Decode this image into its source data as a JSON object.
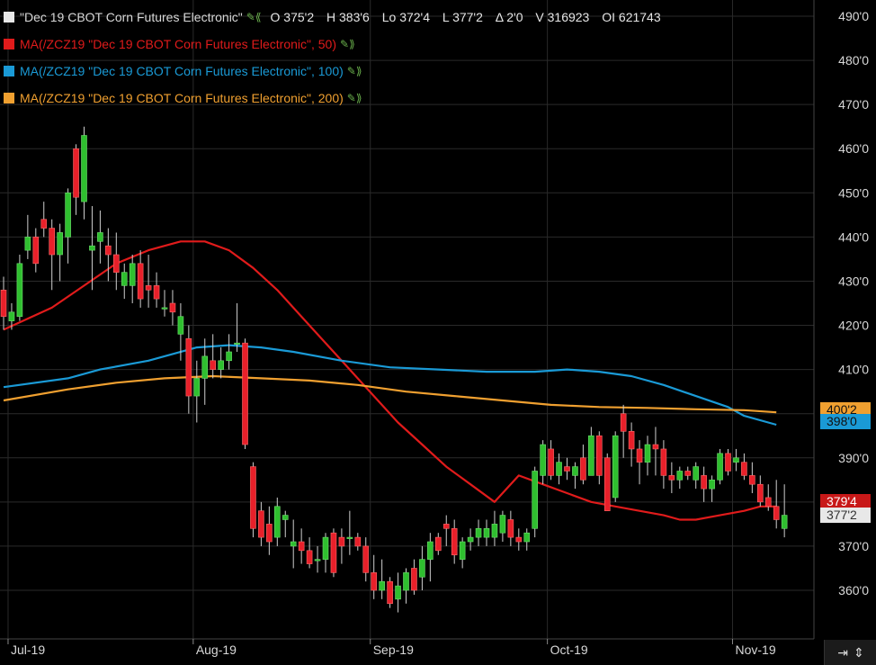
{
  "legend": {
    "main": {
      "label": "\"Dec 19 CBOT Corn Futures Electronic\"",
      "color": "#e8e8e8",
      "stats": {
        "open": "O 375'2",
        "high": "H 383'6",
        "low": "Lo 372'4",
        "last": "L 377'2",
        "change": "Δ 2'0",
        "volume": "V 316923",
        "oi": "OI 621743"
      }
    },
    "ma50": {
      "label": "MA(/ZCZ19 \"Dec 19 CBOT Corn Futures Electronic\", 50)",
      "color": "#e01b1b"
    },
    "ma100": {
      "label": "MA(/ZCZ19 \"Dec 19 CBOT Corn Futures Electronic\", 100)",
      "color": "#1a9ad6"
    },
    "ma200": {
      "label": "MA(/ZCZ19 \"Dec 19 CBOT Corn Futures Electronic\", 200)",
      "color": "#f0a030"
    }
  },
  "badges": {
    "ma200": {
      "text": "400'2",
      "color": "#f0a030"
    },
    "ma100": {
      "text": "398'0",
      "color": "#1a9ad6"
    },
    "ma50": {
      "text": "379'4",
      "color": "#c81818"
    },
    "price": {
      "text": "377'2",
      "color": "#e8e8e8"
    }
  },
  "chart_data": {
    "type": "candlestick",
    "ylim": [
      351,
      492
    ],
    "y_ticks": [
      "490'0",
      "480'0",
      "470'0",
      "460'0",
      "450'0",
      "440'0",
      "430'0",
      "420'0",
      "410'0",
      "400'0",
      "390'0",
      "380'0",
      "370'0",
      "360'0"
    ],
    "y_tick_values": [
      490,
      480,
      470,
      460,
      450,
      440,
      430,
      420,
      410,
      400,
      390,
      380,
      370,
      360
    ],
    "x_labels": [
      {
        "label": "Jul-19",
        "index": 1
      },
      {
        "label": "Aug-19",
        "index": 24
      },
      {
        "label": "Sep-19",
        "index": 46
      },
      {
        "label": "Oct-19",
        "index": 68
      },
      {
        "label": "Nov-19",
        "index": 91
      }
    ],
    "candles": [
      [
        428,
        431,
        419,
        422
      ],
      [
        421,
        425,
        419,
        423
      ],
      [
        422,
        436,
        421,
        434
      ],
      [
        437,
        445,
        435,
        440
      ],
      [
        440,
        442,
        432,
        434
      ],
      [
        444,
        448,
        440,
        442
      ],
      [
        442,
        444,
        428,
        436
      ],
      [
        436,
        443,
        430,
        441
      ],
      [
        440,
        451,
        434,
        450
      ],
      [
        460,
        461,
        445,
        449
      ],
      [
        448,
        465,
        444,
        463
      ],
      [
        437,
        447,
        428,
        438
      ],
      [
        439,
        446,
        434,
        441
      ],
      [
        438,
        442,
        430,
        436
      ],
      [
        436,
        441,
        428,
        432
      ],
      [
        429,
        434,
        426,
        432
      ],
      [
        429,
        436,
        425,
        434
      ],
      [
        434,
        437,
        424,
        426
      ],
      [
        429,
        436,
        424,
        428
      ],
      [
        429,
        432,
        424,
        426
      ],
      [
        424,
        428,
        422,
        424
      ],
      [
        425,
        428,
        420,
        423
      ],
      [
        418,
        425,
        412,
        422
      ],
      [
        417,
        420,
        400,
        404
      ],
      [
        404,
        412,
        398,
        408
      ],
      [
        408,
        417,
        402,
        413
      ],
      [
        412,
        418,
        408,
        410
      ],
      [
        410,
        415,
        408,
        412
      ],
      [
        412,
        418,
        410,
        414
      ],
      [
        416,
        425,
        414,
        416
      ],
      [
        416,
        417,
        392,
        393
      ],
      [
        388,
        389,
        372,
        374
      ],
      [
        378,
        380,
        370,
        372
      ],
      [
        375,
        379,
        368,
        371
      ],
      [
        372,
        381,
        370,
        379
      ],
      [
        376,
        378,
        372,
        377
      ],
      [
        370,
        376,
        365,
        371
      ],
      [
        371,
        374,
        366,
        369
      ],
      [
        369,
        372,
        365,
        366
      ],
      [
        367,
        370,
        364,
        367
      ],
      [
        367,
        373,
        364,
        372
      ],
      [
        373,
        374,
        363,
        364
      ],
      [
        372,
        374,
        366,
        370
      ],
      [
        372,
        378,
        368,
        372
      ],
      [
        372,
        373,
        369,
        370
      ],
      [
        370,
        372,
        362,
        364
      ],
      [
        364,
        368,
        358,
        360
      ],
      [
        360,
        367,
        358,
        362
      ],
      [
        362,
        363,
        356,
        357
      ],
      [
        358,
        364,
        355,
        361
      ],
      [
        360,
        365,
        357,
        364
      ],
      [
        365,
        367,
        359,
        360
      ],
      [
        363,
        370,
        360,
        367
      ],
      [
        367,
        373,
        362,
        371
      ],
      [
        372,
        373,
        368,
        369
      ],
      [
        375,
        377,
        370,
        374
      ],
      [
        374,
        376,
        366,
        368
      ],
      [
        367,
        372,
        365,
        371
      ],
      [
        371,
        374,
        369,
        372
      ],
      [
        372,
        376,
        370,
        374
      ],
      [
        372,
        376,
        370,
        374
      ],
      [
        372,
        378,
        370,
        375
      ],
      [
        373,
        378,
        371,
        377
      ],
      [
        376,
        378,
        370,
        372
      ],
      [
        372,
        374,
        369,
        371
      ],
      [
        371,
        374,
        369,
        373
      ],
      [
        374,
        388,
        372,
        387
      ],
      [
        386,
        394,
        384,
        393
      ],
      [
        392,
        394,
        385,
        386
      ],
      [
        386,
        391,
        384,
        389
      ],
      [
        388,
        390,
        385,
        387
      ],
      [
        386,
        389,
        383,
        388
      ],
      [
        390,
        393,
        384,
        385
      ],
      [
        386,
        397,
        386,
        395
      ],
      [
        395,
        396,
        384,
        386
      ],
      [
        390,
        391,
        378,
        378
      ],
      [
        381,
        396,
        380,
        395
      ],
      [
        400,
        402,
        390,
        396
      ],
      [
        396,
        398,
        388,
        392
      ],
      [
        392,
        394,
        384,
        389
      ],
      [
        389,
        395,
        386,
        393
      ],
      [
        393,
        397,
        386,
        392
      ],
      [
        392,
        394,
        383,
        386
      ],
      [
        386,
        389,
        382,
        385
      ],
      [
        385,
        388,
        383,
        387
      ],
      [
        387,
        388,
        385,
        386
      ],
      [
        385,
        389,
        383,
        388
      ],
      [
        386,
        388,
        380,
        383
      ],
      [
        383,
        386,
        380,
        385
      ],
      [
        385,
        392,
        384,
        391
      ],
      [
        391,
        392,
        386,
        387
      ],
      [
        389,
        392,
        387,
        390
      ],
      [
        389,
        391,
        385,
        386
      ],
      [
        386,
        389,
        382,
        384
      ],
      [
        384,
        386,
        379,
        380
      ],
      [
        381,
        384,
        378,
        379
      ],
      [
        379,
        385,
        374,
        376
      ],
      [
        374,
        384,
        372,
        377
      ]
    ],
    "series": [
      {
        "name": "MA(/ZCZ19 \"Dec 19 CBOT Corn Futures Electronic\", 50)",
        "color": "#e01b1b",
        "points": [
          [
            0,
            419
          ],
          [
            6,
            424
          ],
          [
            10,
            429
          ],
          [
            14,
            434
          ],
          [
            18,
            437
          ],
          [
            22,
            439
          ],
          [
            25,
            439
          ],
          [
            28,
            437
          ],
          [
            31,
            433
          ],
          [
            34,
            428
          ],
          [
            37,
            422
          ],
          [
            40,
            416
          ],
          [
            43,
            410
          ],
          [
            46,
            404
          ],
          [
            49,
            398
          ],
          [
            52,
            393
          ],
          [
            55,
            388
          ],
          [
            58,
            384
          ],
          [
            61,
            380
          ],
          [
            64,
            386
          ],
          [
            67,
            384
          ],
          [
            70,
            382
          ],
          [
            73,
            380
          ],
          [
            76,
            379
          ],
          [
            79,
            378
          ],
          [
            82,
            377
          ],
          [
            84,
            376
          ],
          [
            86,
            376
          ],
          [
            89,
            377
          ],
          [
            92,
            378
          ],
          [
            94,
            379
          ],
          [
            96,
            379
          ]
        ]
      },
      {
        "name": "MA(/ZCZ19 \"Dec 19 CBOT Corn Futures Electronic\", 100)",
        "color": "#1a9ad6",
        "points": [
          [
            0,
            406
          ],
          [
            8,
            408
          ],
          [
            12,
            410
          ],
          [
            18,
            412
          ],
          [
            24,
            415
          ],
          [
            28,
            415.5
          ],
          [
            32,
            415
          ],
          [
            36,
            414
          ],
          [
            42,
            412
          ],
          [
            48,
            410.5
          ],
          [
            54,
            410
          ],
          [
            60,
            409.5
          ],
          [
            66,
            409.5
          ],
          [
            70,
            410
          ],
          [
            74,
            409.5
          ],
          [
            78,
            408.5
          ],
          [
            82,
            406.5
          ],
          [
            86,
            404
          ],
          [
            90,
            401.5
          ],
          [
            92,
            399.5
          ],
          [
            95,
            398
          ],
          [
            96,
            397.5
          ]
        ]
      },
      {
        "name": "MA(/ZCZ19 \"Dec 19 CBOT Corn Futures Electronic\", 200)",
        "color": "#f0a030",
        "points": [
          [
            0,
            403
          ],
          [
            8,
            405.5
          ],
          [
            14,
            407
          ],
          [
            20,
            408
          ],
          [
            26,
            408.5
          ],
          [
            32,
            408
          ],
          [
            38,
            407.5
          ],
          [
            44,
            406.5
          ],
          [
            50,
            405
          ],
          [
            56,
            404
          ],
          [
            62,
            403
          ],
          [
            68,
            402
          ],
          [
            74,
            401.5
          ],
          [
            80,
            401.3
          ],
          [
            86,
            401
          ],
          [
            92,
            400.8
          ],
          [
            96,
            400.3
          ]
        ]
      }
    ]
  }
}
